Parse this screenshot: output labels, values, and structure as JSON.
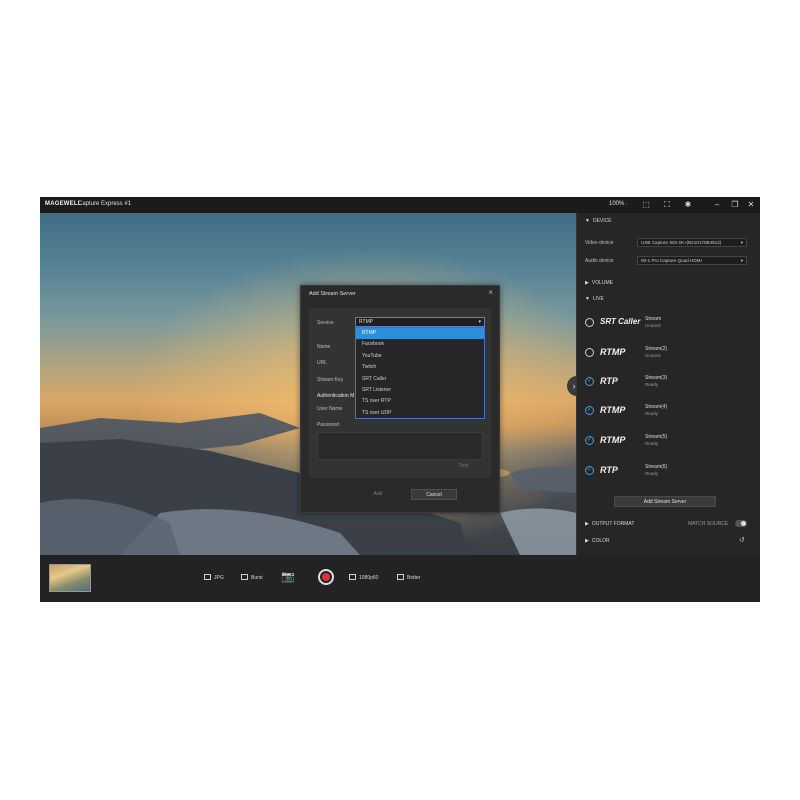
{
  "titlebar": {
    "logo": "MAGEWELL",
    "title": "Capture Express  #1",
    "zoom": "100% .",
    "icons": [
      "fit-icon",
      "fullscreen-icon",
      "settings-icon",
      "minimize-icon",
      "restore-icon",
      "close-icon"
    ]
  },
  "dialog": {
    "title": "Add Stream Server",
    "service_label": "Service",
    "service_value": "RTMP",
    "name_label": "Name",
    "url_label": "URL",
    "stream_key_label": "Stream Key",
    "auth_label": "Authentication M",
    "username_label": "User Name",
    "password_label": "Password",
    "service_options": [
      "RTMP",
      "Facebook",
      "YouTube",
      "Twitch",
      "SRT Caller",
      "SRT Listener",
      "TS over RTP",
      "TS over UDP"
    ],
    "test_label": "Test",
    "add_label": "Add",
    "cancel_label": "Cancel"
  },
  "panel": {
    "device_header": "DEVICE",
    "video_device_label": "Video device",
    "video_device_value": "USB Capture SDI 4K+(B210170B4512)",
    "audio_device_label": "Audio device",
    "audio_device_value": "00-1 Pro Capture Quad HDMI",
    "volume_header": "VOLUME",
    "live_header": "LIVE",
    "live_items": [
      {
        "protocol": "SRT Caller",
        "name": "Stream",
        "state": "Unused",
        "checked": false
      },
      {
        "protocol": "RTMP",
        "name": "Stream(2)",
        "state": "Unused",
        "checked": false
      },
      {
        "protocol": "RTP",
        "name": "Stream(3)",
        "state": "Ready",
        "checked": true
      },
      {
        "protocol": "RTMP",
        "name": "Stream(4)",
        "state": "Ready",
        "checked": true
      },
      {
        "protocol": "RTMP",
        "name": "Stream(5)",
        "state": "Ready",
        "checked": true
      },
      {
        "protocol": "RTP",
        "name": "Stream(6)",
        "state": "Ready",
        "checked": true
      }
    ],
    "add_server_label": "Add Stream Server",
    "output_format_header": "OUTPUT FORMAT",
    "match_source_label": "MATCH SOURCE",
    "color_header": "COLOR"
  },
  "bottombar": {
    "jpg_label": "JPG",
    "burst_label": "Burst",
    "resolution_label": "1080p60",
    "quality_label": "Better"
  },
  "colors": {
    "accent": "#2b8fdc",
    "record": "#e0323a",
    "background": "#262626"
  }
}
